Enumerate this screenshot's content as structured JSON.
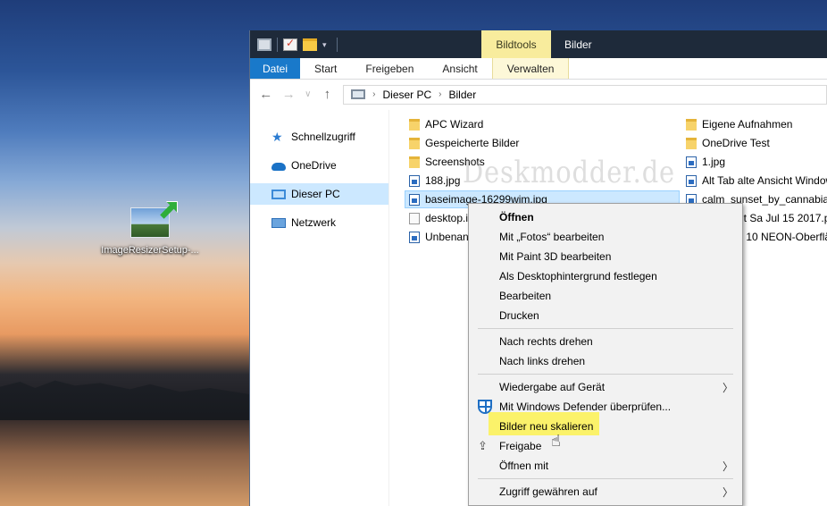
{
  "desktop": {
    "icon_label": "ImageResizerSetup-..."
  },
  "window": {
    "title": "Bilder",
    "contextual_tab_group": "Bildtools",
    "ribbon_tabs": [
      "Datei",
      "Start",
      "Freigeben",
      "Ansicht",
      "Verwalten"
    ]
  },
  "address": {
    "path": [
      "Dieser PC",
      "Bilder"
    ]
  },
  "navpane": {
    "items": [
      "Schnellzugriff",
      "OneDrive",
      "Dieser PC",
      "Netzwerk"
    ]
  },
  "files": {
    "col1": [
      "APC Wizard",
      "Gespeicherte Bilder",
      "Screenshots",
      "188.jpg",
      "baseimage-16299wim.jpg",
      "desktop.i",
      "Unbenan"
    ],
    "col2": [
      "Eigene Aufnahmen",
      "OneDrive Test",
      "1.jpg",
      "Alt Tab alte Ansicht Window",
      "calm_sunset_by_cannabian",
      "nt Sa Jul 15 2017.p",
      "s 10 NEON-Oberflä"
    ]
  },
  "watermark": "Deskmodder.de",
  "context_menu": {
    "items": [
      "Öffnen",
      "Mit „Fotos“ bearbeiten",
      "Mit Paint 3D bearbeiten",
      "Als Desktophintergrund festlegen",
      "Bearbeiten",
      "Drucken",
      "Nach rechts drehen",
      "Nach links drehen",
      "Wiedergabe auf Gerät",
      "Mit Windows Defender überprüfen...",
      "Bilder neu skalieren",
      "Freigabe",
      "Öffnen mit",
      "Zugriff gewähren auf"
    ],
    "highlight_color": "#fbf26a"
  }
}
